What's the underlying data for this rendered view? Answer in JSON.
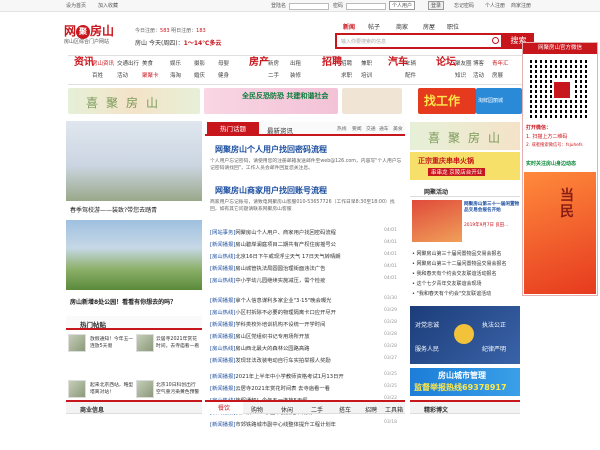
{
  "topbar": {
    "home": "设为首页",
    "fav": "加入收藏",
    "user_label": "登陆名",
    "pwd_label": "密码",
    "role": "个人用户",
    "login": "登录",
    "forgot": "忘记密码",
    "center": "个人注册",
    "business": "商家注册"
  },
  "logo": {
    "name1": "网",
    "name2": "聚",
    "name3": "房山",
    "slogan": "房山区综合门户网站"
  },
  "date": {
    "today": "今日注册：",
    "today_n": "583",
    "yesterday": "明日注册：",
    "yest_n": "183"
  },
  "weather": {
    "city": "房山",
    "date": "今天(周四)",
    "temp": "1～14℃多云"
  },
  "search": {
    "tabs": [
      "新闻",
      "帖子",
      "商家",
      "房屋",
      "职位"
    ],
    "placeholder": "输入你要搜索的信息",
    "button": "搜索"
  },
  "categories": [
    {
      "name": "资讯",
      "subs": [
        "房山资讯",
        "交通出行",
        "百姓",
        "活动"
      ],
      "first": "房山资讯",
      "red": "聚聚卡"
    },
    {
      "name": "生活",
      "subs": [
        "美食",
        "娱乐",
        "二手",
        "海淘"
      ]
    },
    {
      "name": "服务",
      "subs": [
        "摄影",
        "婚庆",
        "母婴",
        "健身"
      ]
    },
    {
      "name": "房产",
      "subs": [
        "新房",
        "二手",
        "出租",
        "装修"
      ]
    },
    {
      "name": "招聘",
      "subs": [
        "招聘",
        "求职",
        "兼职",
        "培训"
      ]
    },
    {
      "name": "汽车",
      "subs": [
        "车辆",
        "配件",
        "车友"
      ]
    },
    {
      "name": "论坛",
      "subs": [
        "聚友圈",
        "知识",
        "谈天",
        "情感"
      ]
    },
    {
      "name": "",
      "subs": [
        "博客",
        "活动",
        "青年汇",
        "房展"
      ]
    }
  ],
  "banners": {
    "b1": "喜聚房山",
    "b2": "全民反恐防恐 共建和谐社会",
    "b3": "找工作",
    "b4": "淘鲜园丽城"
  },
  "qr": {
    "title": "网聚房山官方微信",
    "line1": "打开微信：",
    "line2": "1. 扫描上方二维码",
    "line3": "2. 或者搜索微信号：fsjuhefs",
    "line4": "实时关注房山身边动态"
  },
  "left": {
    "cap1": "春季驾校游——装致?带您去踏青",
    "cap2": "房山新增8处公园！看看有你想去的吗？",
    "hot": "热门帖贴",
    "posts": [
      {
        "a": "放假通知！今年五一连放5天假",
        "b": "云居寺2021年赏花时间，去寺庙看一看"
      },
      {
        "a": "起来北京西站，略型塔离对站！",
        "b": "北京10日科创出行空气重污染黄色预警"
      }
    ]
  },
  "mid": {
    "tabs": [
      "热门话题",
      "最新资讯"
    ],
    "links": [
      "热线",
      "要闻",
      "交通",
      "通车",
      "美食"
    ],
    "h1": "网聚房山个人用户找回密码流程",
    "p1": "个人用户忘记密码，请使用您的注册邮箱发送邮件至web@126.com，内容写\"个人用户忘记密码请找回\"，工作人员会邮件回复您关注息。",
    "h2": "网聚房山商家用户找回账号流程",
    "p2": "商家用户忘记账号，请致电网聚房山客服010-53657726（工作日早8:30至18:00）找回，如有其它问题请联系网聚房山客服",
    "news": [
      {
        "tag": "[网站事务]",
        "t": "网聚房山个人用户、商家用户找回密码流程",
        "d": "04/01"
      },
      {
        "tag": "[新闻播报]",
        "t": "房山碧岸澜庭项目二期共有产权住房摇号公",
        "d": "04/01"
      },
      {
        "tag": "[房山热线]",
        "t": "北京16日下午或现浮尘天气 17日天气转晴朗",
        "d": "04/01"
      },
      {
        "tag": "[新闻播报]",
        "t": "房山城管执法局圆圆治理街面违法广告",
        "d": "04/01"
      },
      {
        "tag": "[房山热线]",
        "t": "中小学幼儿园继续实施减压，需个检疫",
        "d": "04/01"
      },
      {
        "tag": "[新闻播报]",
        "t": "拿个人信息谋利多家企业\"3·15\"晚会曝光",
        "d": "03/30"
      },
      {
        "tag": "[房山热线]",
        "t": "小区村拆除不必要的物理隔离卡口应开尽开",
        "d": "03/29"
      },
      {
        "tag": "[新闻播报]",
        "t": "学科类校外培训机构不设统一开学时间",
        "d": "03/28"
      },
      {
        "tag": "[新闻播报]",
        "t": "房山区党组织书记专用场所开放",
        "d": "03/28"
      },
      {
        "tag": "[房山热线]",
        "t": "房山西北最大的森林公园路高路",
        "d": "03/28"
      },
      {
        "tag": "[新闻播报]",
        "t": "发现非法改装电动自行车实拍举报人奖励",
        "d": "03/27"
      },
      {
        "tag": "[新闻播报]",
        "t": "2021年上半年中小学教师资格考试1月13日开",
        "d": "03/25"
      },
      {
        "tag": "[新闻播报]",
        "t": "云居寺2021年赏花时间表 去寺庙看一看",
        "d": "03/25"
      },
      {
        "tag": "[房山热线]",
        "t": "放假通知！今年五一连放5天假",
        "d": "03/22"
      },
      {
        "tag": "[新闻播报]",
        "t": "良乡镇2021学生不要复活节成期",
        "d": "03/20"
      },
      {
        "tag": "[新闻播报]",
        "t": "市郊铁路城市副中心线整体提升工程计划年",
        "d": "03/18"
      }
    ]
  },
  "right": {
    "ad1": "喜聚房山",
    "ad2": "正宗重庆串串火锅",
    "ad2b": "串串龙 京陵店台开业",
    "hd": "网聚活动",
    "items": [
      {
        "t": "网聚房山第三十届闲置物品交易会报名",
        "d": ""
      },
      {
        "t": "网聚房山第三十二届闲置物品交易会报名",
        "d": ""
      },
      {
        "t": "我和春天有个约会交友联谊活动报名",
        "d": ""
      },
      {
        "t": "这个七夕青年交友联谊会现场",
        "d": ""
      },
      {
        "t": "\"我和春天有个约会\"交友联谊活动",
        "d": ""
      }
    ],
    "promo1": "网聚房山第三十一届闲置物品交易会报名开始",
    "promo2": "2019年9月7日 良田...",
    "ad3": "对党忠诚",
    "ad3b": "执法公正",
    "ad3c": "服务人民",
    "ad3d": "纪律严明",
    "ad4": "房山城市管理",
    "ad4b": "监督举报热线69378917"
  },
  "bottom": {
    "left": "商业信息",
    "tabs": [
      "餐饮",
      "购物",
      "休闲",
      "二手",
      "搭车",
      "招聘",
      "工具箱"
    ],
    "right": "精彩博文"
  }
}
